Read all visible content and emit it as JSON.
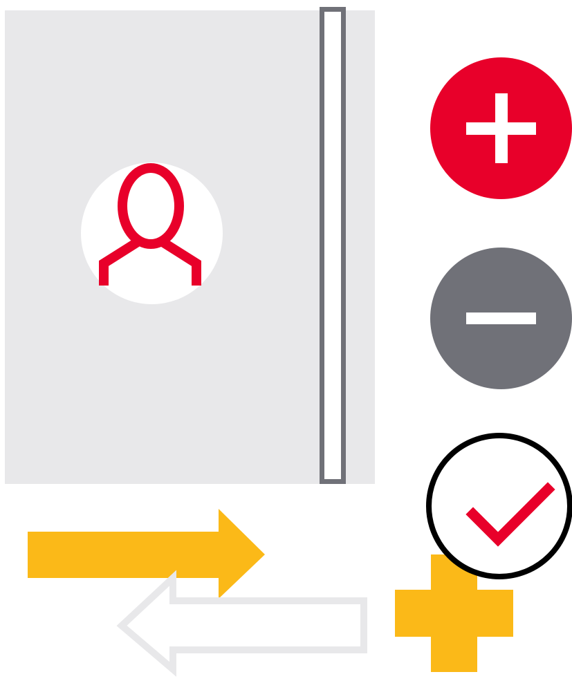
{
  "illustration": {
    "profile_panel": {
      "icon": "user-avatar-icon"
    },
    "actions": [
      {
        "name": "add",
        "icon": "plus-icon"
      },
      {
        "name": "remove",
        "icon": "minus-icon"
      },
      {
        "name": "confirm",
        "icon": "check-icon"
      }
    ],
    "decorations": {
      "forward_arrow_icon": "arrow-right-icon",
      "back_arrow_icon": "arrow-left-icon",
      "plus_shape_icon": "plus-shape-icon"
    }
  },
  "colors": {
    "accent": "#e8002a",
    "muted": "#707178",
    "panel": "#e8e8ea",
    "yellow": "#fbb918",
    "outline": "#000000"
  }
}
